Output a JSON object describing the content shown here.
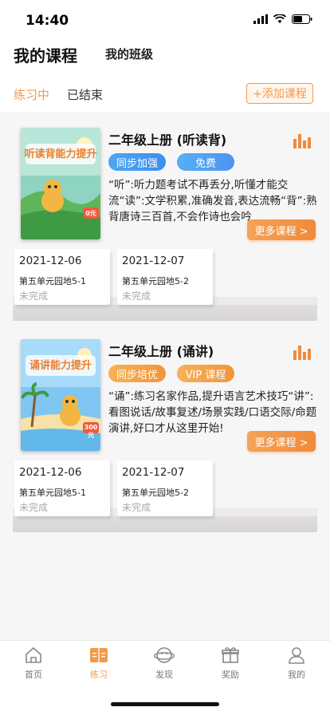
{
  "status_bar": {
    "time": "14:40"
  },
  "header": {
    "tabs": [
      {
        "label": "我的课程",
        "active": true
      },
      {
        "label": "我的班级",
        "active": false
      }
    ]
  },
  "subtabs": {
    "active": "练习中",
    "inactive": "已结束",
    "add_button": "+添加课程"
  },
  "courses": [
    {
      "cover_text": "听读背能力提升",
      "cover_badge": "0元",
      "title": "二年级上册 (听读背)",
      "tags": [
        "同步加强",
        "免费"
      ],
      "description": "“听”:听力题考试不再丢分,听懂才能交流“读”:文学积累,准确发音,表达流畅“背”:熟背唐诗三百首,不会作诗也会吟",
      "more_button": "更多课程 >",
      "lessons": [
        {
          "date": "2021-12-06",
          "unit": "第五单元园地5-1",
          "status": "未完成"
        },
        {
          "date": "2021-12-07",
          "unit": "第五单元园地5-2",
          "status": "未完成"
        }
      ]
    },
    {
      "cover_text": "诵讲能力提升",
      "cover_badge": "300元",
      "title": "二年级上册 (诵讲)",
      "tags": [
        "同步培优",
        "VIP 课程"
      ],
      "description": "“诵”:练习名家作品,提升语言艺术技巧“讲”:看图说话/故事复述/场景实践/口语交际/命题演讲,好口才从这里开始!",
      "more_button": "更多课程 >",
      "lessons": [
        {
          "date": "2021-12-06",
          "unit": "第五单元园地5-1",
          "status": "未完成"
        },
        {
          "date": "2021-12-07",
          "unit": "第五单元园地5-2",
          "status": "未完成"
        }
      ]
    }
  ],
  "tabbar": {
    "items": [
      {
        "label": "首页",
        "icon": "home-icon"
      },
      {
        "label": "练习",
        "icon": "practice-icon",
        "active": true
      },
      {
        "label": "发现",
        "icon": "discover-icon"
      },
      {
        "label": "奖励",
        "icon": "gift-icon"
      },
      {
        "label": "我的",
        "icon": "profile-icon"
      }
    ]
  },
  "colors": {
    "accent": "#f29a4a",
    "blue": "#3b8ef2",
    "background": "#f7f6f6"
  }
}
